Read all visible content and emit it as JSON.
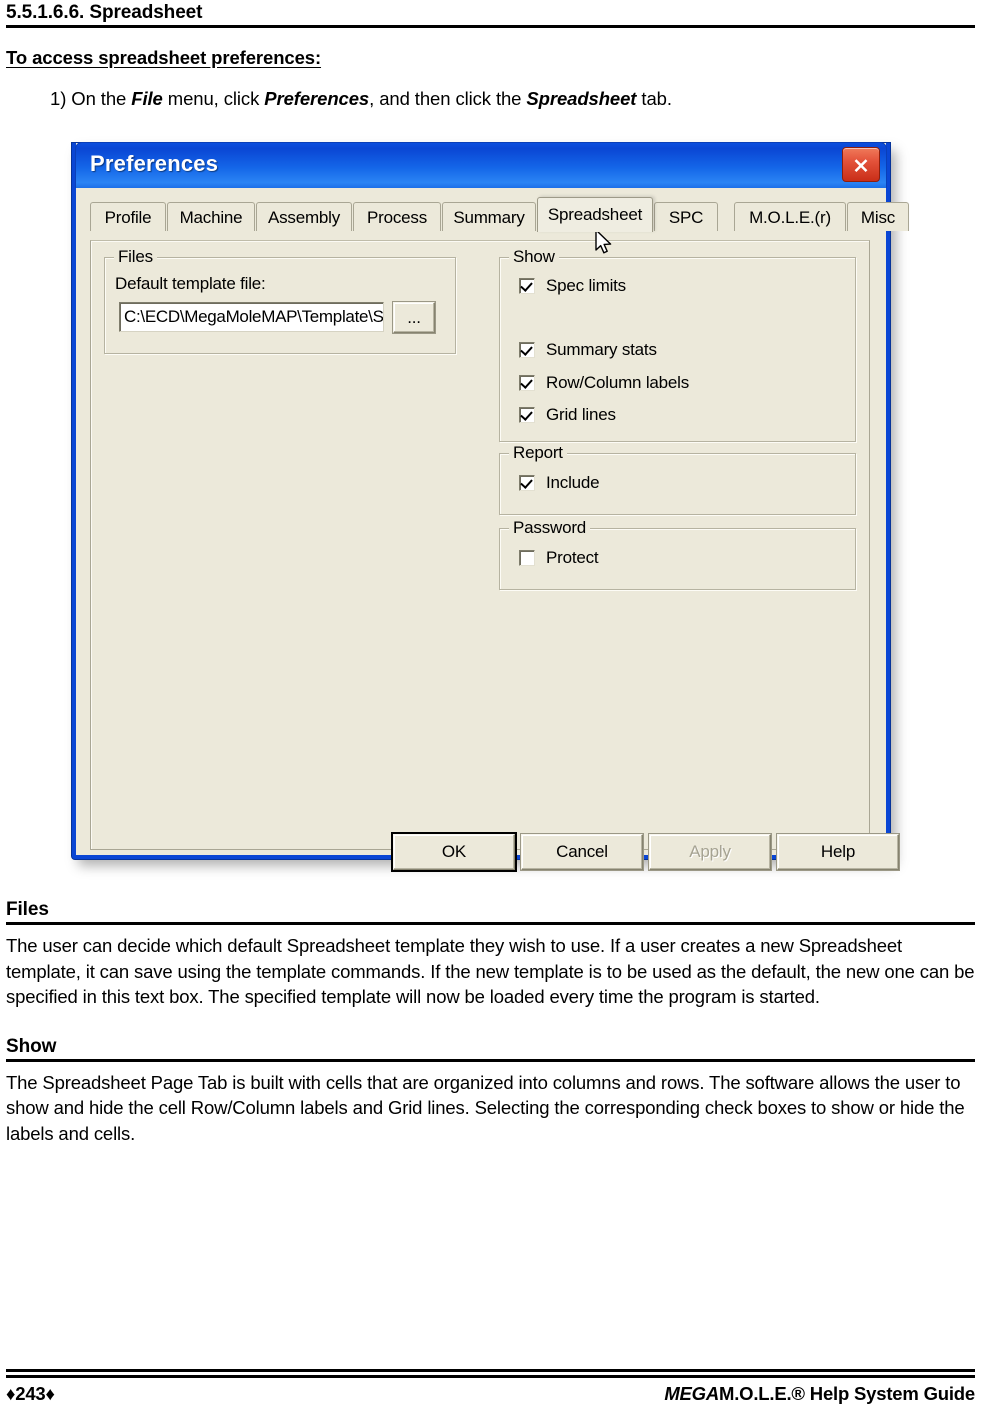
{
  "page": {
    "heading": "5.5.1.6.6. Spreadsheet",
    "subheading": "To access spreadsheet preferences:",
    "step_prefix": "1) On the ",
    "step_b1": "File",
    "step_mid1": " menu, click ",
    "step_b2": "Preferences",
    "step_mid2": ", and then click the ",
    "step_b3": "Spreadsheet",
    "step_suffix": " tab.",
    "sections": [
      {
        "title": "Files",
        "body": "The user can decide which default Spreadsheet template they wish to use. If a user creates a new Spreadsheet template, it can save using the template commands. If the new template is to be used as the default, the new one can be specified in this text box. The specified template will now be loaded every time the program is started."
      },
      {
        "title": "Show",
        "body": "The Spreadsheet Page Tab is built with cells that are organized into columns and rows. The software allows the user to show and hide the cell Row/Column labels and Grid lines. Selecting the corresponding check boxes to show or hide the labels and cells."
      }
    ]
  },
  "footer": {
    "page_number": "♦243♦",
    "guide_italic": "MEGA",
    "guide_rest": "M.O.L.E.® Help System Guide"
  },
  "dialog": {
    "title": "Preferences",
    "close_icon": "close-icon",
    "tabs": [
      {
        "label": "Profile",
        "selected": false
      },
      {
        "label": "Machine",
        "selected": false
      },
      {
        "label": "Assembly",
        "selected": false
      },
      {
        "label": "Process",
        "selected": false
      },
      {
        "label": "Summary",
        "selected": false
      },
      {
        "label": "Spreadsheet",
        "selected": true
      },
      {
        "label": "SPC",
        "selected": false
      },
      {
        "label": "M.O.L.E.(r)",
        "selected": false
      },
      {
        "label": "Misc",
        "selected": false
      }
    ],
    "files_group": {
      "title": "Files",
      "label": "Default template file:",
      "value": "C:\\ECD\\MegaMoleMAP\\Template\\Sprea",
      "browse_label": "..."
    },
    "show_group": {
      "title": "Show",
      "items": [
        {
          "label": "Spec limits",
          "checked": true
        },
        {
          "label": "Summary stats",
          "checked": true
        },
        {
          "label": "Row/Column labels",
          "checked": true
        },
        {
          "label": "Grid lines",
          "checked": true
        }
      ]
    },
    "report_group": {
      "title": "Report",
      "items": [
        {
          "label": "Include",
          "checked": true
        }
      ]
    },
    "password_group": {
      "title": "Password",
      "items": [
        {
          "label": "Protect",
          "checked": false
        }
      ]
    },
    "buttons": [
      {
        "label": "OK",
        "state": "default"
      },
      {
        "label": "Cancel",
        "state": "normal"
      },
      {
        "label": "Apply",
        "state": "disabled"
      },
      {
        "label": "Help",
        "state": "normal"
      }
    ],
    "colors": {
      "titlebar_blue": "#0A46D4",
      "face": "#ECE9DA",
      "close_red": "#C92E18"
    }
  }
}
